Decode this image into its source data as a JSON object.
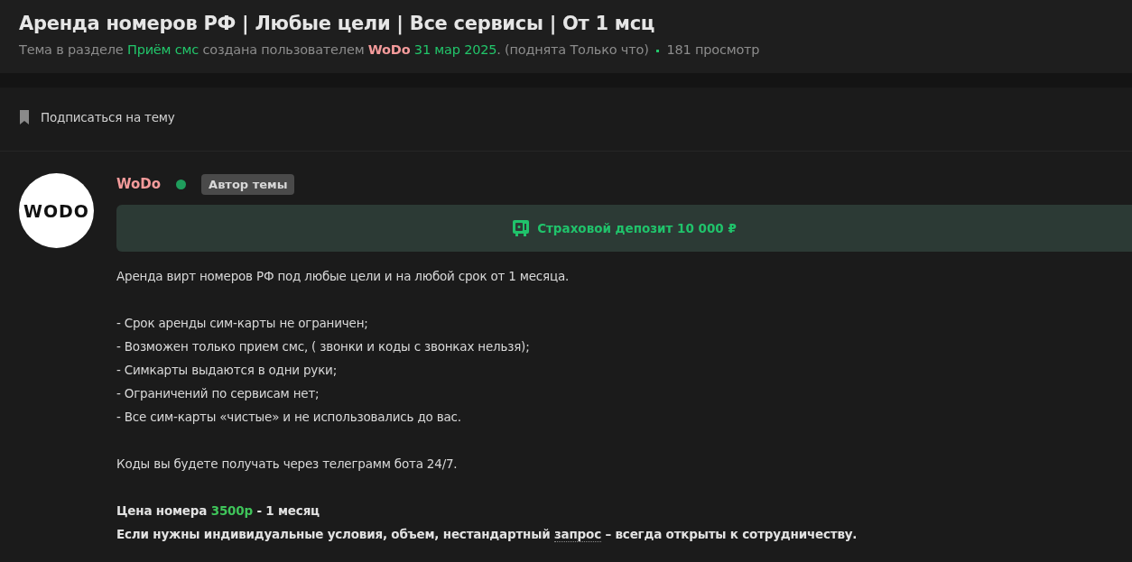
{
  "title": "Аренда номеров РФ | Любые цели | Все сервисы | От 1 мсц",
  "meta": [
    {
      "kind": "text",
      "text": "Тема в разделе"
    },
    {
      "kind": "link",
      "text": "Приём смс"
    },
    {
      "kind": "text",
      "text": "создана пользователем"
    },
    {
      "kind": "user",
      "text": "WoDo"
    },
    {
      "kind": "link",
      "text": "31 мар 2025"
    },
    {
      "kind": "text",
      "text": ". (поднята Только что)",
      "join": true
    },
    {
      "kind": "dot"
    },
    {
      "kind": "text",
      "text": "181 просмотр"
    }
  ],
  "subscribe": {
    "label": "Подписаться на тему"
  },
  "post": {
    "avatar": "WODO",
    "author": "WoDo",
    "online": true,
    "badge": "Автор темы",
    "deposit": "Страховой депозит 10 000 ₽",
    "paragraphs": [
      {
        "kind": "plain",
        "lines": [
          [
            {
              "kind": "text",
              "text": "Аренда вирт номеров РФ под любые цели и на любой срок от 1 месяца."
            }
          ]
        ]
      },
      {
        "kind": "plain",
        "lines": [
          [
            {
              "kind": "text",
              "text": "- Срок аренды сим-карты не ограничен;"
            }
          ],
          [
            {
              "kind": "text",
              "text": "- Возможен только прием смс, ( звонки и коды с звонках нельзя);"
            }
          ],
          [
            {
              "kind": "text",
              "text": "- Симкарты выдаются в одни руки;"
            }
          ],
          [
            {
              "kind": "text",
              "text": "- Ограничений по сервисам нет;"
            }
          ],
          [
            {
              "kind": "text",
              "text": "- Все сим-карты «чистые» и не использовались до вас."
            }
          ]
        ]
      },
      {
        "kind": "plain",
        "lines": [
          [
            {
              "kind": "text",
              "text": "Коды вы будете получать через телеграмм бота 24/7."
            }
          ]
        ]
      },
      {
        "kind": "bold",
        "lines": [
          [
            {
              "kind": "text",
              "text": "Цена номера"
            },
            {
              "kind": "price",
              "text": "3500р"
            },
            {
              "kind": "text",
              "text": "- 1 месяц"
            }
          ],
          [
            {
              "kind": "text",
              "text": "Если нужны индивидуальные условия, объем, нестандартный"
            },
            {
              "kind": "term",
              "text": "запрос"
            },
            {
              "kind": "text",
              "text": "– всегда открыты к сотрудничеству."
            }
          ]
        ]
      }
    ]
  }
}
